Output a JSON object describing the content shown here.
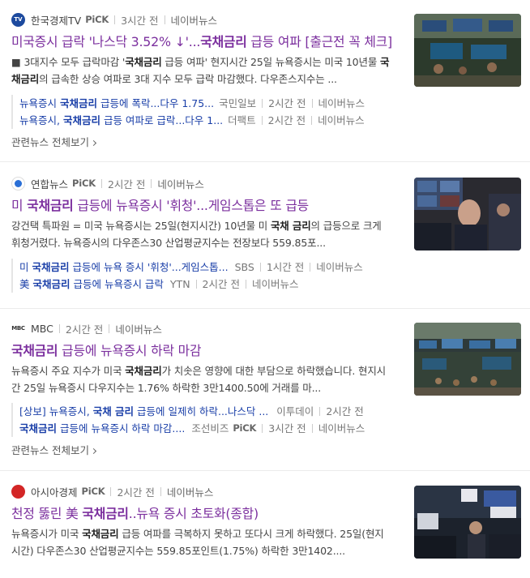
{
  "colors": {
    "title_visited": "#7b2f9e",
    "related_link": "#1a3fa8",
    "divider": "#ebebeb"
  },
  "cards": [
    {
      "press": "한국경제TV",
      "pick": "PiCK",
      "time": "3시간 전",
      "naver_news": "네이버뉴스",
      "title_pre": "미국증시 급락 '나스닥 3.52% ↓'...",
      "title_bold": "국채금리",
      "title_post": " 급등 여파 [출근전 꼭 체크]",
      "desc_1": "■ 3대지수 모두 급락마감 '",
      "desc_bold_1": "국채금리",
      "desc_2": " 급등 여파' 현지시간 25일 뉴욕증시는 미국 10년물 ",
      "desc_bold_2": "국채금리",
      "desc_3": "의 급속한 상승 여파로 3대 지수 모두 급락 마감했다. 다우존스지수는 ...",
      "related": [
        {
          "pre": "뉴욕증시 ",
          "bold": "국채금리",
          "post": " 급등에 폭락...다우 1.75...",
          "press": "국민일보",
          "time": "2시간 전",
          "naver": "네이버뉴스"
        },
        {
          "pre": "뉴욕증시, ",
          "bold": "국채금리",
          "post": " 급등 여파로 급락...다우 1...",
          "press": "더팩트",
          "time": "2시간 전",
          "naver": "네이버뉴스"
        }
      ],
      "more": "관련뉴스 전체보기"
    },
    {
      "press": "연합뉴스",
      "pick": "PiCK",
      "time": "2시간 전",
      "naver_news": "네이버뉴스",
      "title_pre": "미 ",
      "title_bold": "국채금리",
      "title_post": " 급등에 뉴욕증시 '휘청'...게임스톱은 또 급등",
      "desc_1": "강건택 특파원 = 미국 뉴욕증시는 25일(현지시간) 10년물 미 ",
      "desc_bold_1": "국채 금리",
      "desc_2": "의 급등으로 크게 휘청거렸다. 뉴욕증시의 다우존스30 산업평균지수는 전장보다 559.85포...",
      "desc_bold_2": "",
      "desc_3": "",
      "related": [
        {
          "pre": "미 ",
          "bold": "국채금리",
          "post": " 급등에 뉴욕 증시 '휘청'...게임스톱...",
          "press": "SBS",
          "time": "1시간 전",
          "naver": "네이버뉴스"
        },
        {
          "pre": "美 ",
          "bold": "국채금리",
          "post": " 급등에 뉴욕증시 급락",
          "press": "YTN",
          "time": "2시간 전",
          "naver": "네이버뉴스"
        }
      ],
      "more": ""
    },
    {
      "press": "MBC",
      "pick": "",
      "time": "2시간 전",
      "naver_news": "네이버뉴스",
      "title_pre": "",
      "title_bold": "국채금리",
      "title_post": " 급등에 뉴욕증시 하락 마감",
      "desc_1": "뉴욕증시 주요 지수가 미국 ",
      "desc_bold_1": "국채금리",
      "desc_2": "가 치솟은 영향에 대한 부담으로 하락했습니다. 현지시간 25일 뉴욕증시 다우지수는 1.76% 하락한 3만1400.50에 거래를 마...",
      "desc_bold_2": "",
      "desc_3": "",
      "related": [
        {
          "pre": "[상보] 뉴욕증시, ",
          "bold": "국채 금리",
          "post": " 급등에 일제히 하락...나스닥 ...",
          "press": "이투데이",
          "time": "2시간 전",
          "naver": ""
        },
        {
          "pre": "",
          "bold": "국채금리",
          "post": " 급등에 뉴욕증시 하락 마감....",
          "press": "조선비즈",
          "press_pick": "PiCK",
          "time": "3시간 전",
          "naver": "네이버뉴스"
        }
      ],
      "more": "관련뉴스 전체보기"
    },
    {
      "press": "아시아경제",
      "pick": "PiCK",
      "time": "2시간 전",
      "naver_news": "네이버뉴스",
      "title_pre": "천정 뚫린 美 ",
      "title_bold": "국채금리",
      "title_post": "..뉴욕 증시 초토화(종합)",
      "desc_1": "뉴욕증시가 미국 ",
      "desc_bold_1": "국채금리",
      "desc_2": " 급등 여파를 극복하지 못하고 또다시 크게 하락했다. 25일(현지시간) 다우존스30 산업평균지수는 559.85포인트(1.75%) 하락한 3만1402....",
      "desc_bold_2": "",
      "desc_3": "",
      "related": [],
      "more": ""
    }
  ]
}
